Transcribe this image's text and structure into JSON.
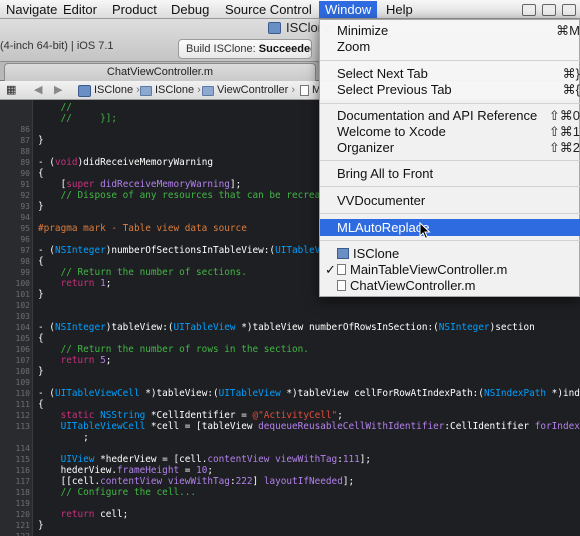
{
  "menubar": {
    "items": [
      "Navigate",
      "Editor",
      "Product",
      "Debug",
      "Source Control",
      "Window",
      "Help"
    ],
    "active_index": 5
  },
  "toolbar": {
    "scheme": "(4-inch 64-bit) | iOS 7.1",
    "window_title": "ISClone",
    "activity_prefix": "Build ISClone: ",
    "activity_status": "Succeeded"
  },
  "tab": {
    "label": "ChatViewController.m"
  },
  "jumpbar": {
    "crumbs": [
      "ISClone",
      "ISClone",
      "ViewController",
      "M"
    ]
  },
  "editor": {
    "lines": [
      {
        "num": "",
        "segs": [
          [
            "c",
            "    //"
          ]
        ]
      },
      {
        "num": "",
        "segs": [
          [
            "c",
            "    //     }];"
          ]
        ]
      },
      {
        "num": "86",
        "segs": []
      },
      {
        "num": "87",
        "segs": [
          [
            "w",
            "}"
          ]
        ]
      },
      {
        "num": "88",
        "segs": []
      },
      {
        "num": "89",
        "segs": [
          [
            "w",
            "- ("
          ],
          [
            "k",
            "void"
          ],
          [
            "w",
            ")didReceiveMemoryWarning"
          ]
        ]
      },
      {
        "num": "90",
        "segs": [
          [
            "w",
            "{"
          ]
        ]
      },
      {
        "num": "91",
        "segs": [
          [
            "w",
            "    ["
          ],
          [
            "k",
            "super"
          ],
          [
            "w",
            " "
          ],
          [
            "n",
            "didReceiveMemoryWarning"
          ],
          [
            "w",
            "];"
          ]
        ]
      },
      {
        "num": "92",
        "segs": [
          [
            "c",
            "    // Dispose of any resources that can be recrea"
          ]
        ]
      },
      {
        "num": "93",
        "segs": [
          [
            "w",
            "}"
          ]
        ]
      },
      {
        "num": "94",
        "segs": []
      },
      {
        "num": "95",
        "segs": [
          [
            "p",
            "#pragma mark - Table view data source"
          ]
        ]
      },
      {
        "num": "96",
        "segs": []
      },
      {
        "num": "97",
        "segs": [
          [
            "w",
            "- ("
          ],
          [
            "t",
            "NSInteger"
          ],
          [
            "w",
            ")numberOfSectionsInTableView:("
          ],
          [
            "t",
            "UITableV"
          ]
        ]
      },
      {
        "num": "98",
        "segs": [
          [
            "w",
            "{"
          ]
        ]
      },
      {
        "num": "99",
        "segs": [
          [
            "c",
            "    // Return the number of sections."
          ]
        ]
      },
      {
        "num": "100",
        "segs": [
          [
            "w",
            "    "
          ],
          [
            "k",
            "return"
          ],
          [
            "w",
            " "
          ],
          [
            "n",
            "1"
          ],
          [
            "w",
            ";"
          ]
        ]
      },
      {
        "num": "101",
        "segs": [
          [
            "w",
            "}"
          ]
        ]
      },
      {
        "num": "102",
        "segs": []
      },
      {
        "num": "103",
        "segs": []
      },
      {
        "num": "104",
        "segs": [
          [
            "w",
            "- ("
          ],
          [
            "t",
            "NSInteger"
          ],
          [
            "w",
            ")tableView:("
          ],
          [
            "t",
            "UITableView"
          ],
          [
            "w",
            " *)tableView numberOfRowsInSection:("
          ],
          [
            "t",
            "NSInteger"
          ],
          [
            "w",
            ")section"
          ]
        ]
      },
      {
        "num": "105",
        "segs": [
          [
            "w",
            "{"
          ]
        ]
      },
      {
        "num": "106",
        "segs": [
          [
            "c",
            "    // Return the number of rows in the section."
          ]
        ]
      },
      {
        "num": "107",
        "segs": [
          [
            "w",
            "    "
          ],
          [
            "k",
            "return"
          ],
          [
            "w",
            " "
          ],
          [
            "n",
            "5"
          ],
          [
            "w",
            ";"
          ]
        ]
      },
      {
        "num": "108",
        "segs": [
          [
            "w",
            "}"
          ]
        ]
      },
      {
        "num": "109",
        "segs": []
      },
      {
        "num": "110",
        "segs": [
          [
            "w",
            "- ("
          ],
          [
            "t",
            "UITableViewCell"
          ],
          [
            "w",
            " *)tableView:("
          ],
          [
            "t",
            "UITableView"
          ],
          [
            "w",
            " *)tableView cellForRowAtIndexPath:("
          ],
          [
            "t",
            "NSIndexPath"
          ],
          [
            "w",
            " *)ind"
          ]
        ]
      },
      {
        "num": "111",
        "segs": [
          [
            "w",
            "{"
          ]
        ]
      },
      {
        "num": "112",
        "segs": [
          [
            "w",
            "    "
          ],
          [
            "k",
            "static"
          ],
          [
            "w",
            " "
          ],
          [
            "t",
            "NSString"
          ],
          [
            "w",
            " *CellIdentifier = "
          ],
          [
            "s",
            "@\"ActivityCell\""
          ],
          [
            "w",
            ";"
          ]
        ]
      },
      {
        "num": "113",
        "segs": [
          [
            "w",
            "    "
          ],
          [
            "t",
            "UITableViewCell"
          ],
          [
            "w",
            " *cell = [tableView "
          ],
          [
            "n",
            "dequeueReusableCellWithIdentifier"
          ],
          [
            "w",
            ":CellIdentifier "
          ],
          [
            "n",
            "forIndex"
          ]
        ]
      },
      {
        "num": "",
        "segs": [
          [
            "w",
            "        ;"
          ]
        ]
      },
      {
        "num": "114",
        "segs": []
      },
      {
        "num": "115",
        "segs": [
          [
            "w",
            "    "
          ],
          [
            "t",
            "UIView"
          ],
          [
            "w",
            " *hederView = [cell."
          ],
          [
            "n",
            "contentView"
          ],
          [
            "w",
            " "
          ],
          [
            "n",
            "viewWithTag"
          ],
          [
            "w",
            ":"
          ],
          [
            "n",
            "111"
          ],
          [
            "w",
            "];"
          ]
        ]
      },
      {
        "num": "116",
        "segs": [
          [
            "w",
            "    hederView."
          ],
          [
            "n",
            "frameHeight"
          ],
          [
            "w",
            " = "
          ],
          [
            "n",
            "10"
          ],
          [
            "w",
            ";"
          ]
        ]
      },
      {
        "num": "117",
        "segs": [
          [
            "w",
            "    [[cell."
          ],
          [
            "n",
            "contentView"
          ],
          [
            "w",
            " "
          ],
          [
            "n",
            "viewWithTag"
          ],
          [
            "w",
            ":"
          ],
          [
            "n",
            "222"
          ],
          [
            "w",
            "] "
          ],
          [
            "n",
            "layoutIfNeeded"
          ],
          [
            "w",
            "];"
          ]
        ]
      },
      {
        "num": "118",
        "segs": [
          [
            "c",
            "    // Configure the cell..."
          ]
        ]
      },
      {
        "num": "119",
        "segs": []
      },
      {
        "num": "120",
        "segs": [
          [
            "w",
            "    "
          ],
          [
            "k",
            "return"
          ],
          [
            "w",
            " cell;"
          ]
        ]
      },
      {
        "num": "121",
        "segs": [
          [
            "w",
            "}"
          ]
        ]
      },
      {
        "num": "122",
        "segs": []
      }
    ]
  },
  "window_menu": {
    "minimize": {
      "label": "Minimize",
      "shortcut": "⌘M"
    },
    "zoom": {
      "label": "Zoom"
    },
    "select_next_tab": {
      "label": "Select Next Tab",
      "shortcut": "⌘}"
    },
    "select_previous_tab": {
      "label": "Select Previous Tab",
      "shortcut": "⌘{"
    },
    "docs": {
      "label": "Documentation and API Reference",
      "shortcut": "⇧⌘0"
    },
    "welcome": {
      "label": "Welcome to Xcode",
      "shortcut": "⇧⌘1"
    },
    "organizer": {
      "label": "Organizer",
      "shortcut": "⇧⌘2"
    },
    "bring_all": {
      "label": "Bring All to Front"
    },
    "vvdocumenter": {
      "label": "VVDocumenter"
    },
    "mlautoreplace": {
      "label": "MLAutoReplace"
    },
    "win_isclone": {
      "label": "ISClone"
    },
    "win_main": {
      "label": "MainTableViewController.m"
    },
    "win_chat": {
      "label": "ChatViewController.m"
    }
  },
  "colors": {
    "accent": "#2f6be0",
    "editor_bg": "#1e1f22",
    "comment": "#41b645",
    "keyword": "#c6327d",
    "type": "#00a0ff",
    "string": "#e44c3a",
    "number": "#b281eb"
  },
  "icons": [
    "project-icon",
    "folder-icon",
    "file-icon",
    "checkmark-icon",
    "arrow-cursor-icon"
  ]
}
